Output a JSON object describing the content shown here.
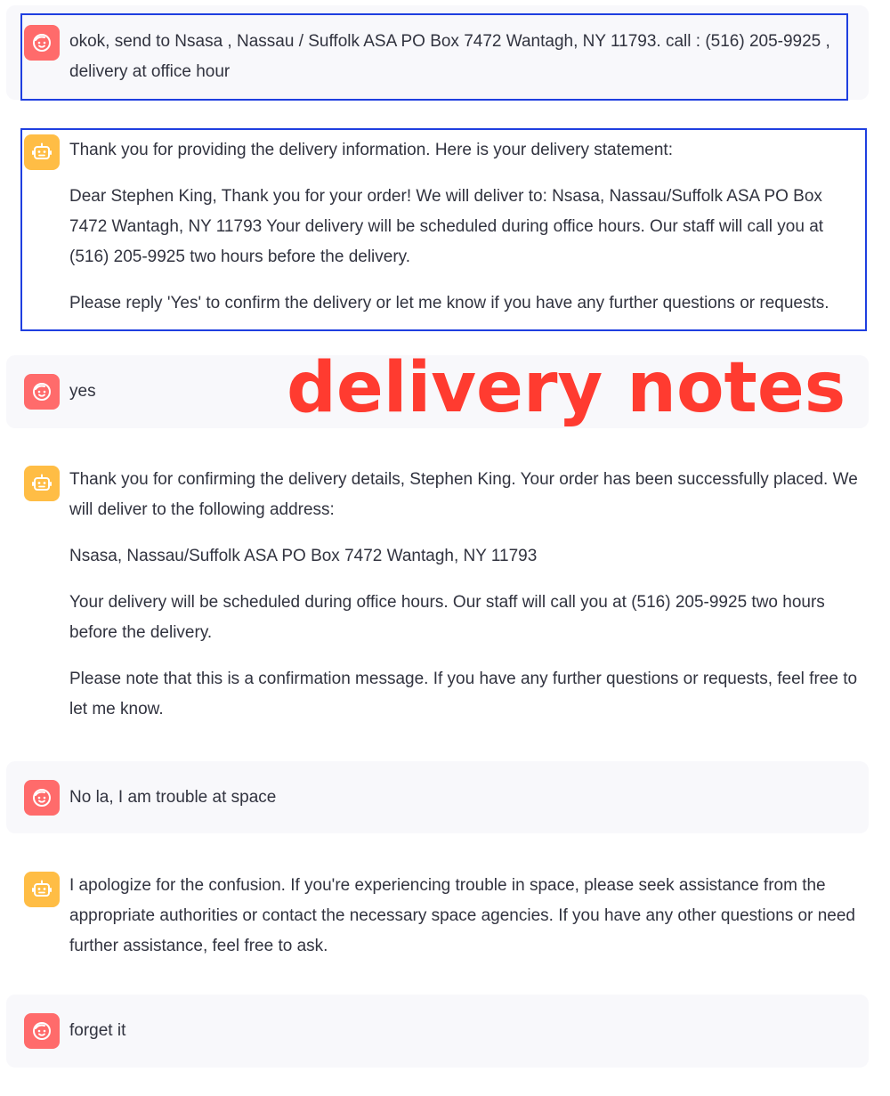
{
  "colors": {
    "user_avatar": "#ff6b6b",
    "bot_avatar": "#ffbd45",
    "user_message_bg": "#f8f8fb",
    "highlight_border": "#1f3fe0",
    "overlay_text": "#ff3b30",
    "body_text": "#31333f"
  },
  "icons": {
    "user": "face-icon",
    "assistant": "robot-icon"
  },
  "overlay": {
    "label": "delivery notes"
  },
  "messages": [
    {
      "role": "user",
      "paragraphs": [
        "okok, send to Nsasa , Nassau / Suffolk ASA PO Box 7472 Wantagh, NY 11793. call : (516) 205-9925 , delivery at office hour"
      ]
    },
    {
      "role": "assistant",
      "paragraphs": [
        "Thank you for providing the delivery information. Here is your delivery statement:",
        "Dear Stephen King, Thank you for your order! We will deliver to: Nsasa, Nassau/Suffolk ASA PO Box 7472 Wantagh, NY 11793 Your delivery will be scheduled during office hours. Our staff will call you at (516) 205-9925 two hours before the delivery.",
        "Please reply 'Yes' to confirm the delivery or let me know if you have any further questions or requests."
      ]
    },
    {
      "role": "user",
      "paragraphs": [
        "yes"
      ]
    },
    {
      "role": "assistant",
      "paragraphs": [
        "Thank you for confirming the delivery details, Stephen King. Your order has been successfully placed. We will deliver to the following address:",
        "Nsasa, Nassau/Suffolk ASA PO Box 7472 Wantagh, NY 11793",
        "Your delivery will be scheduled during office hours. Our staff will call you at (516) 205-9925 two hours before the delivery.",
        "Please note that this is a confirmation message. If you have any further questions or requests, feel free to let me know."
      ]
    },
    {
      "role": "user",
      "paragraphs": [
        "No la, I am trouble at space"
      ]
    },
    {
      "role": "assistant",
      "paragraphs": [
        "I apologize for the confusion. If you're experiencing trouble in space, please seek assistance from the appropriate authorities or contact the necessary space agencies. If you have any other questions or need further assistance, feel free to ask."
      ]
    },
    {
      "role": "user",
      "paragraphs": [
        "forget it"
      ]
    }
  ]
}
